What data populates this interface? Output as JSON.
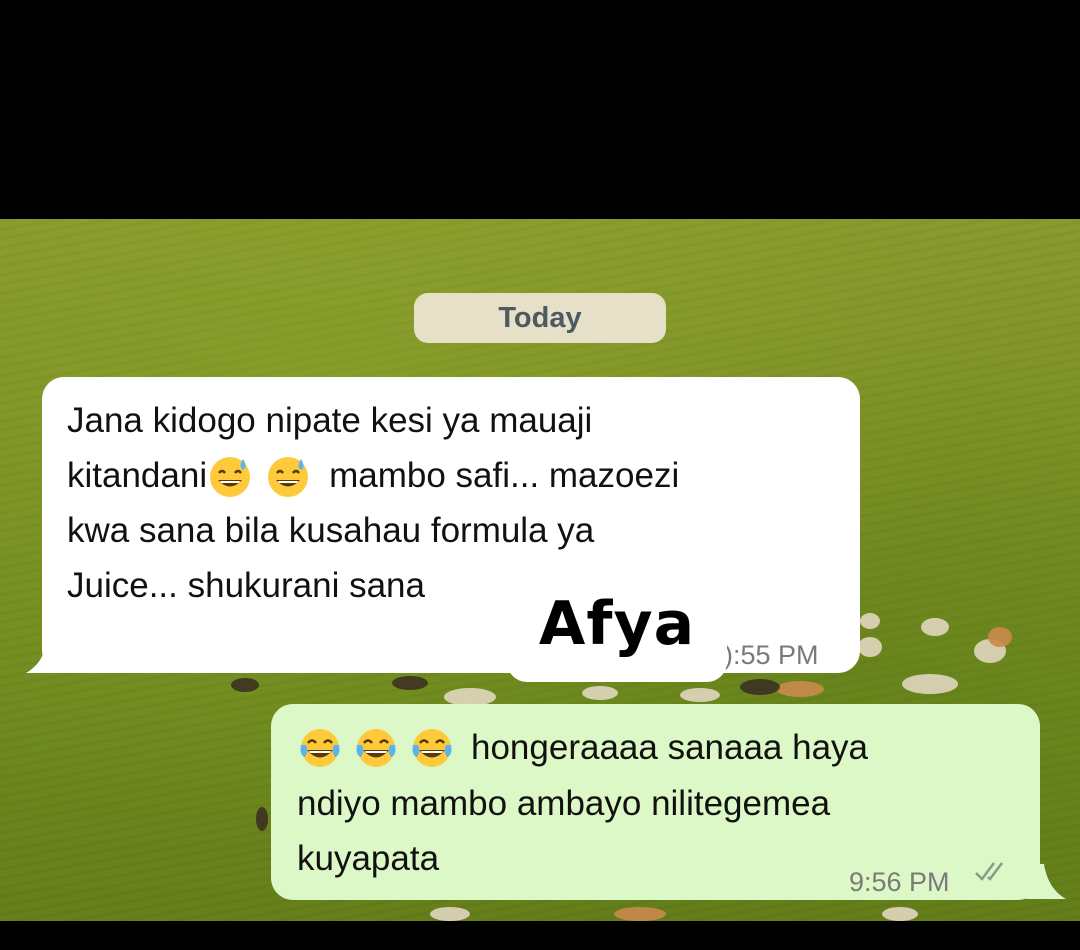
{
  "date_separator": "Today",
  "incoming": {
    "lines": [
      "Jana kidogo nipate kesi ya mauaji",
      "kitandani",
      "mambo safi... mazoezi",
      "kwa sana bila kusahau formula ya",
      "Juice... shukurani sana"
    ],
    "emojis": [
      "sweat-smile-emoji",
      "sweat-smile-emoji"
    ],
    "time": "):55 PM"
  },
  "outgoing": {
    "emojis": [
      "tears-of-joy-emoji",
      "tears-of-joy-emoji",
      "tears-of-joy-emoji"
    ],
    "lines": [
      "hongeraaaa sanaaa haya",
      "ndiyo mambo ambayo nilitegemea",
      "kuyapata"
    ],
    "time": "9:56 PM",
    "status_icon": "double-check-icon"
  },
  "watermark": "Afya",
  "colors": {
    "incoming_bubble": "#ffffff",
    "outgoing_bubble": "#dcf8c6",
    "date_chip": "#e6e0c8",
    "wallpaper": "#7d9226"
  }
}
